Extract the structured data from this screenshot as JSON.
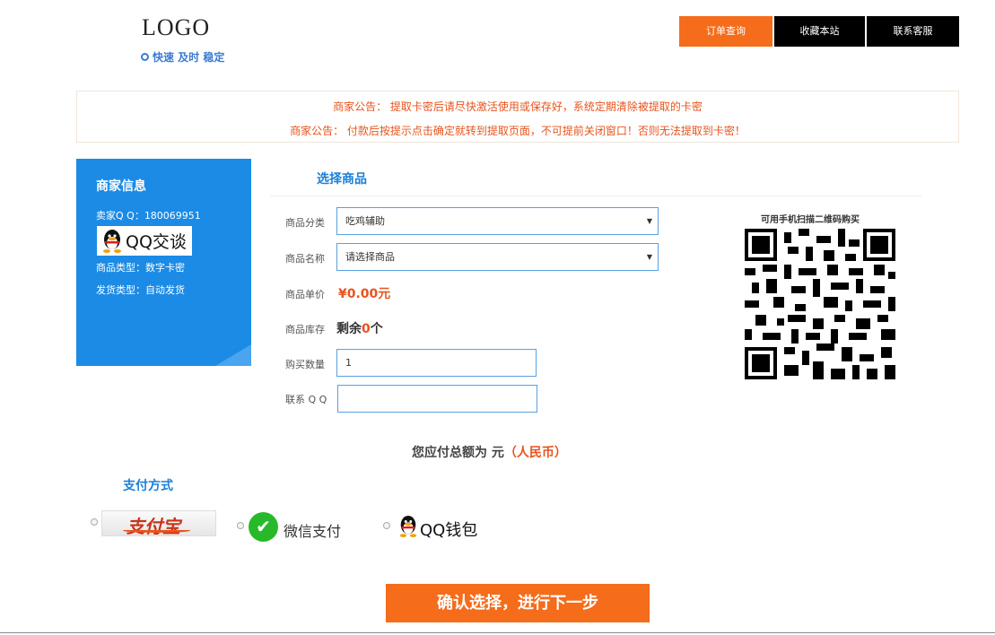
{
  "header": {
    "logo": "LOGO",
    "tagline": "快速 及时 稳定",
    "nav": [
      {
        "label": "订单查询"
      },
      {
        "label": "收藏本站"
      },
      {
        "label": "联系客服"
      }
    ]
  },
  "notice": {
    "line1": "商家公告： 提取卡密后请尽快激活使用或保存好，系统定期清除被提取的卡密",
    "line2": "商家公告： 付款后按提示点击确定就转到提取页面，不可提前关闭窗口！否则无法提取到卡密！"
  },
  "merchant": {
    "title": "商家信息",
    "qq": "卖家Q Q：180069951",
    "qq_talk": "QQ交谈",
    "product_type": "商品类型：数字卡密",
    "delivery_type": "发货类型：自动发货"
  },
  "form": {
    "section_title": "选择商品",
    "category_label": "商品分类",
    "category_value": "吃鸡辅助",
    "name_label": "商品名称",
    "name_value": "请选择商品",
    "price_label": "商品单价",
    "price_value": "¥0.00元",
    "stock_label": "商品库存",
    "stock_prefix": "剩余",
    "stock_count": "0",
    "stock_suffix": "个",
    "qty_label": "购买数量",
    "qty_value": "1",
    "qq_label": "联系 Q Q",
    "qq_value": ""
  },
  "qr": {
    "caption": "可用手机扫描二维码购买"
  },
  "total": {
    "text": "您应付总额为 元",
    "currency": "（人民币）"
  },
  "payment": {
    "title": "支付方式",
    "alipay": "支付宝",
    "wechat": "微信支付",
    "qqwallet": "QQ钱包"
  },
  "confirm": {
    "label": "确认选择，进行下一步"
  },
  "colors": {
    "accent_orange": "#f56c1b",
    "accent_blue": "#1b8be6",
    "notice_text": "#e8541d",
    "wechat_green": "#27b92a"
  }
}
